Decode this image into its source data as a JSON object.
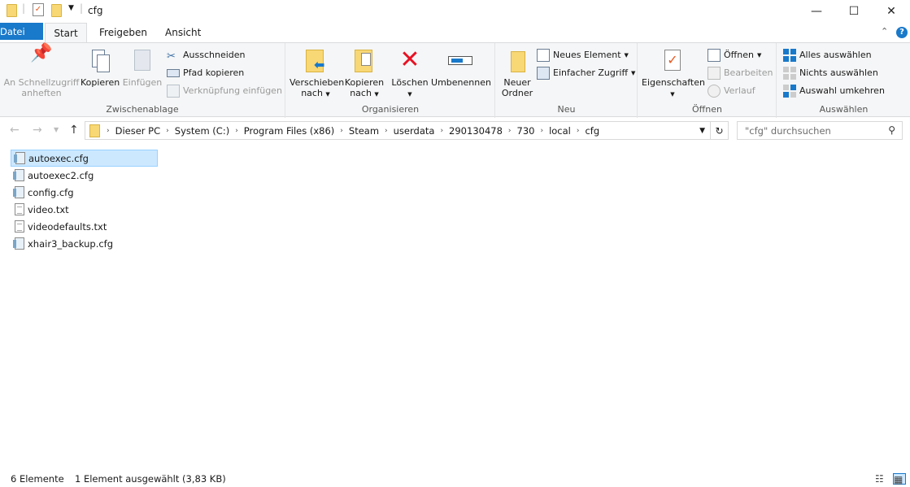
{
  "window": {
    "title": "cfg",
    "minimize": "—",
    "maximize": "☐",
    "close": "✕"
  },
  "tabs": {
    "file": "Datei",
    "start": "Start",
    "share": "Freigeben",
    "view": "Ansicht"
  },
  "ribbon": {
    "clipboard": {
      "label": "Zwischenablage",
      "pin": "An Schnellzugriff anheften",
      "copy": "Kopieren",
      "paste": "Einfügen",
      "cut": "Ausschneiden",
      "copy_path": "Pfad kopieren",
      "paste_shortcut": "Verknüpfung einfügen"
    },
    "organize": {
      "label": "Organisieren",
      "move_to": "Verschieben nach",
      "copy_to": "Kopieren nach",
      "delete": "Löschen",
      "rename": "Umbenennen"
    },
    "new": {
      "label": "Neu",
      "new_folder": "Neuer Ordner",
      "new_item": "Neues Element",
      "easy_access": "Einfacher Zugriff"
    },
    "open": {
      "label": "Öffnen",
      "properties": "Eigenschaften",
      "open": "Öffnen",
      "edit": "Bearbeiten",
      "history": "Verlauf"
    },
    "select": {
      "label": "Auswählen",
      "select_all": "Alles auswählen",
      "select_none": "Nichts auswählen",
      "invert": "Auswahl umkehren"
    }
  },
  "address": {
    "crumbs": [
      "Dieser PC",
      "System (C:)",
      "Program Files (x86)",
      "Steam",
      "userdata",
      "290130478",
      "730",
      "local",
      "cfg"
    ],
    "search_placeholder": "\"cfg\" durchsuchen"
  },
  "files": [
    {
      "name": "autoexec.cfg",
      "type": "cfg",
      "selected": true
    },
    {
      "name": "autoexec2.cfg",
      "type": "cfg",
      "selected": false
    },
    {
      "name": "config.cfg",
      "type": "cfg",
      "selected": false
    },
    {
      "name": "video.txt",
      "type": "txt",
      "selected": false
    },
    {
      "name": "videodefaults.txt",
      "type": "txt",
      "selected": false
    },
    {
      "name": "xhair3_backup.cfg",
      "type": "cfg",
      "selected": false
    }
  ],
  "status": {
    "count": "6 Elemente",
    "selection": "1 Element ausgewählt (3,83 KB)"
  },
  "colors": {
    "accent": "#1979ca",
    "selection": "#cce8ff",
    "delete_red": "#e81123"
  }
}
